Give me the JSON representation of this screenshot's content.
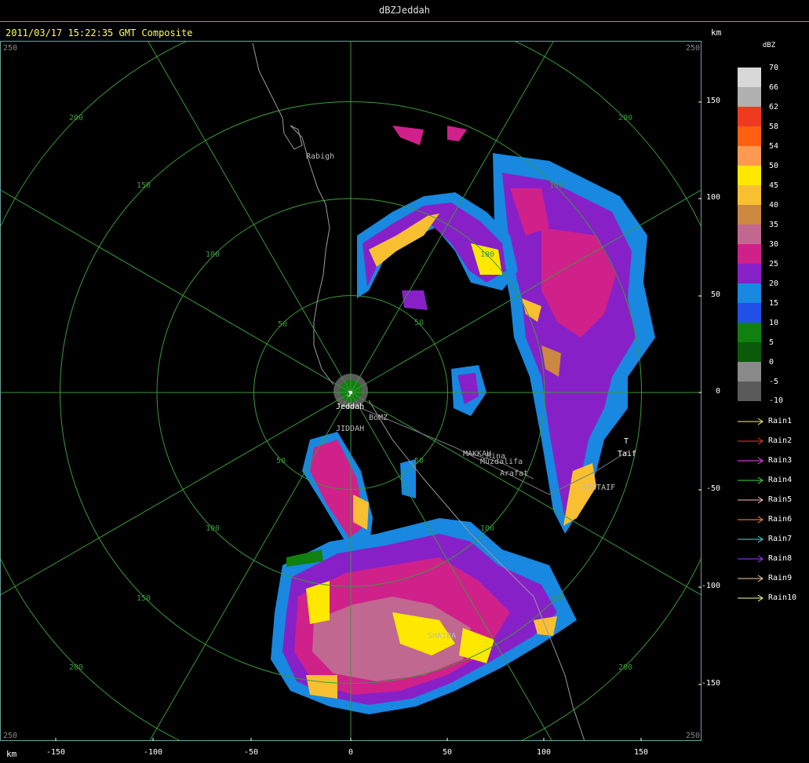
{
  "window": {
    "title": "dBZJeddah"
  },
  "header": {
    "datetime": "2011/03/17 15:22:35 GMT",
    "product": "Composite"
  },
  "axes": {
    "unit_label": "km",
    "x_ticks": [
      "-150",
      "-100",
      "-50",
      "0",
      "50",
      "100",
      "150"
    ],
    "y_ticks": [
      "150",
      "100",
      "50",
      "0",
      "-50",
      "-100",
      "-150"
    ],
    "corner_label": "250",
    "range_rings": [
      "50",
      "100",
      "150",
      "200"
    ],
    "radial_labels": [
      "50",
      "50",
      "50",
      "50",
      "100",
      "100",
      "100",
      "100",
      "150",
      "150",
      "150",
      "150",
      "200",
      "200",
      "200",
      "200"
    ]
  },
  "places": {
    "rabigh": "Rabigh",
    "jeddah_marker": "J",
    "jeddah": "Jeddah",
    "jeddah_station": "JIDDAH",
    "bomz": "BoMZ",
    "makkah": "MAKKAH",
    "mina": "Mina",
    "muzdalifa": "Muzdalifa",
    "arafat": "Arafat",
    "taif_marker": "T",
    "taif": "Taif",
    "atstaif": "ATSTAIF",
    "shaiba": "SHAIBA"
  },
  "legend": {
    "title": "dBZ",
    "scale": [
      {
        "label": "70",
        "color": "#d8d8d8"
      },
      {
        "label": "66",
        "color": "#b0b0b0"
      },
      {
        "label": "62",
        "color": "#f03a20"
      },
      {
        "label": "58",
        "color": "#ff6010"
      },
      {
        "label": "54",
        "color": "#ff9850"
      },
      {
        "label": "50",
        "color": "#ffe800"
      },
      {
        "label": "45",
        "color": "#f8c030"
      },
      {
        "label": "40",
        "color": "#cc8840"
      },
      {
        "label": "35",
        "color": "#c06890"
      },
      {
        "label": "30",
        "color": "#d0208a"
      },
      {
        "label": "25",
        "color": "#8820c8"
      },
      {
        "label": "20",
        "color": "#1888e0"
      },
      {
        "label": "15",
        "color": "#2050e8"
      },
      {
        "label": "10",
        "color": "#108010"
      },
      {
        "label": "5",
        "color": "#0a5a0a"
      },
      {
        "label": "0",
        "color": "#8a8a8a"
      },
      {
        "label": "-5",
        "color": "#5a5a5a"
      },
      {
        "label": "-10",
        "color": "#3a3a3a"
      }
    ],
    "rain_gauges": [
      {
        "label": "Rain1",
        "color": "#ffff40"
      },
      {
        "label": "Rain2",
        "color": "#ff3030"
      },
      {
        "label": "Rain3",
        "color": "#ff40ff"
      },
      {
        "label": "Rain4",
        "color": "#40e040"
      },
      {
        "label": "Rain5",
        "color": "#ffc0c0"
      },
      {
        "label": "Rain6",
        "color": "#ff9050"
      },
      {
        "label": "Rain7",
        "color": "#40e0e0"
      },
      {
        "label": "Rain8",
        "color": "#a040ff"
      },
      {
        "label": "Rain9",
        "color": "#ffd0a0"
      },
      {
        "label": "Rain10",
        "color": "#ffff80"
      }
    ]
  },
  "colors": {
    "grid": "#3a9a3a",
    "frame": "#6fa0a0",
    "header_text": "#ffff55",
    "coast": "#9a9a9a"
  }
}
